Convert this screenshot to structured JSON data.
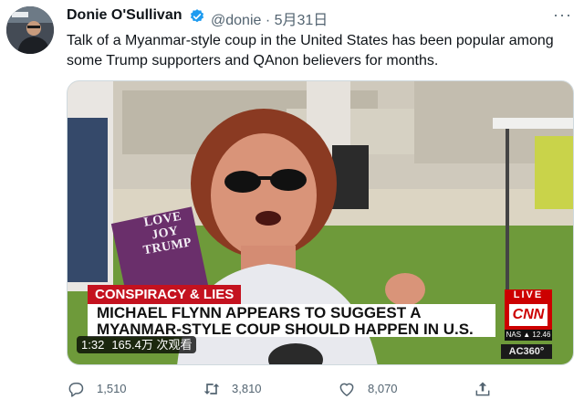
{
  "tweet": {
    "author_name": "Donie O'Sullivan",
    "handle_and_date": "@donie · 5月31日",
    "more_icon": "more-dots-icon",
    "text": "Talk of a Myanmar-style coup in the United States has been popular among some Trump supporters and QAnon believers for months."
  },
  "video": {
    "sign_line1": "LOVE",
    "sign_line2": "JOY",
    "sign_line3": "TRUMP",
    "chyron_tag": "CONSPIRACY & LIES",
    "chyron_line1": "MICHAEL FLYNN APPEARS TO SUGGEST A",
    "chyron_line2": "MYANMAR-STYLE COUP SHOULD HAPPEN IN U.S.",
    "live_label": "LIVE",
    "network_logo": "CNN",
    "ticker": "NAS ▲ 12.46",
    "show_tag": "AC360°",
    "duration": "1:32",
    "views": "165.4万 次观看"
  },
  "actions": {
    "replies": "1,510",
    "retweets": "3,810",
    "likes": "8,070"
  },
  "colors": {
    "verified": "#1d9bf0",
    "secondary_text": "#536471",
    "cnn_red": "#cc0000"
  }
}
